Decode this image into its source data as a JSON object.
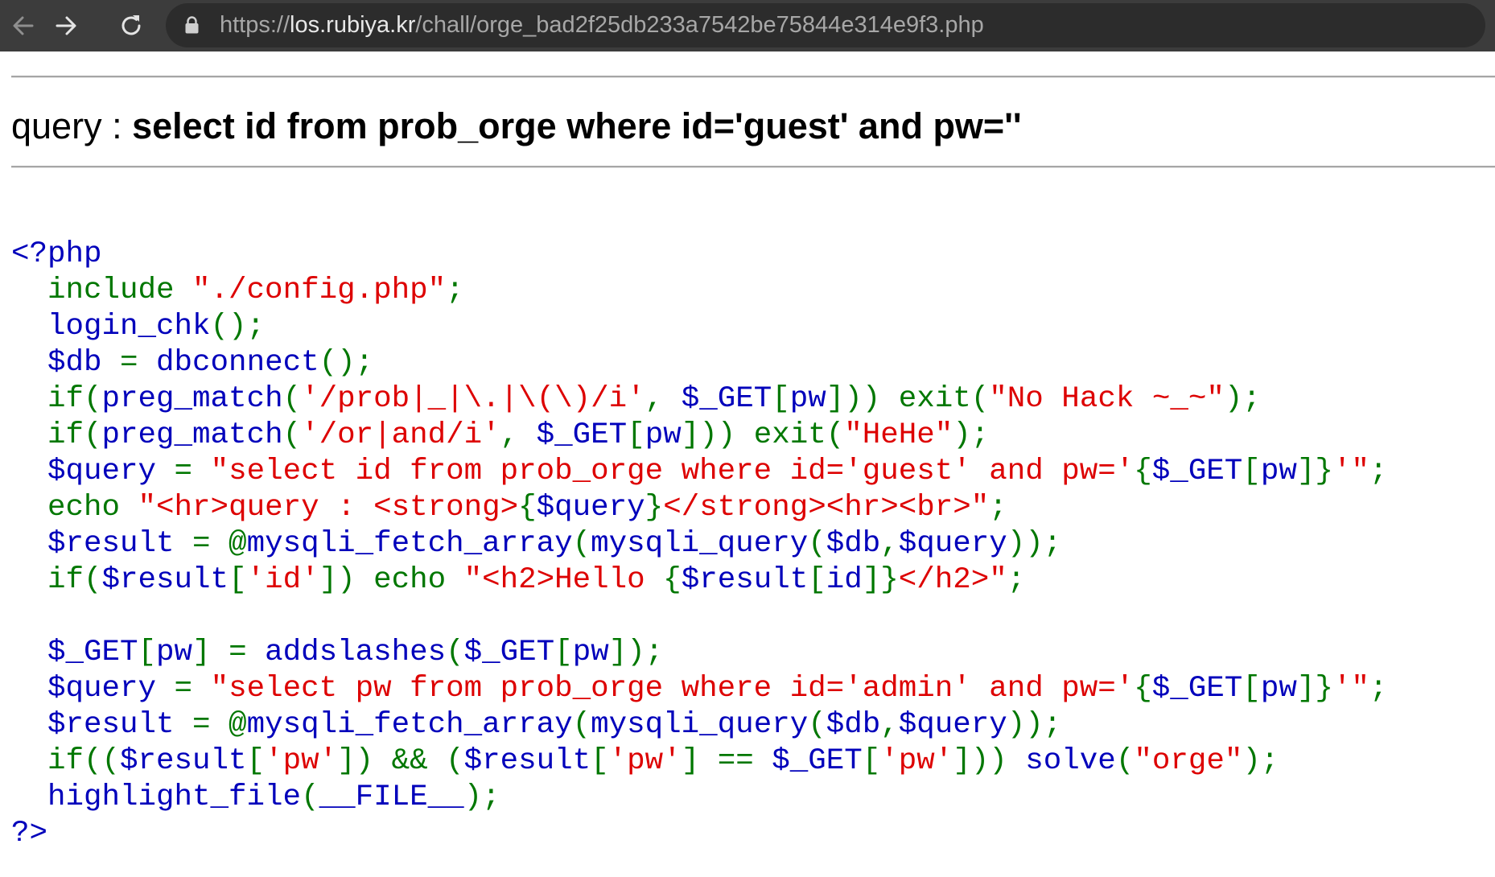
{
  "browser": {
    "url_scheme": "https://",
    "url_host": "los.rubiya.kr",
    "url_path": "/chall/orge_bad2f25db233a7542be75844e314e9f3.php"
  },
  "page": {
    "query_label": "query : ",
    "query_text": "select id from prob_orge where id='guest' and pw=''"
  },
  "code": {
    "lines": [
      [
        {
          "t": "<?php",
          "c": "d"
        }
      ],
      [
        {
          "t": "  ",
          "c": "d"
        },
        {
          "t": "include ",
          "c": "k"
        },
        {
          "t": "\"./config.php\"",
          "c": "s"
        },
        {
          "t": ";",
          "c": "k"
        }
      ],
      [
        {
          "t": "  login_chk",
          "c": "d"
        },
        {
          "t": "();",
          "c": "k"
        }
      ],
      [
        {
          "t": "  $db ",
          "c": "d"
        },
        {
          "t": "= ",
          "c": "k"
        },
        {
          "t": "dbconnect",
          "c": "d"
        },
        {
          "t": "();",
          "c": "k"
        }
      ],
      [
        {
          "t": "  ",
          "c": "d"
        },
        {
          "t": "if(",
          "c": "k"
        },
        {
          "t": "preg_match",
          "c": "d"
        },
        {
          "t": "(",
          "c": "k"
        },
        {
          "t": "'/prob|_|\\.|\\(\\)/i'",
          "c": "s"
        },
        {
          "t": ", ",
          "c": "k"
        },
        {
          "t": "$_GET",
          "c": "d"
        },
        {
          "t": "[",
          "c": "k"
        },
        {
          "t": "pw",
          "c": "d"
        },
        {
          "t": "])) exit(",
          "c": "k"
        },
        {
          "t": "\"No Hack ~_~\"",
          "c": "s"
        },
        {
          "t": ");",
          "c": "k"
        }
      ],
      [
        {
          "t": "  ",
          "c": "d"
        },
        {
          "t": "if(",
          "c": "k"
        },
        {
          "t": "preg_match",
          "c": "d"
        },
        {
          "t": "(",
          "c": "k"
        },
        {
          "t": "'/or|and/i'",
          "c": "s"
        },
        {
          "t": ", ",
          "c": "k"
        },
        {
          "t": "$_GET",
          "c": "d"
        },
        {
          "t": "[",
          "c": "k"
        },
        {
          "t": "pw",
          "c": "d"
        },
        {
          "t": "])) exit(",
          "c": "k"
        },
        {
          "t": "\"HeHe\"",
          "c": "s"
        },
        {
          "t": ");",
          "c": "k"
        }
      ],
      [
        {
          "t": "  $query ",
          "c": "d"
        },
        {
          "t": "= ",
          "c": "k"
        },
        {
          "t": "\"select id from prob_orge where id='guest' and pw='",
          "c": "s"
        },
        {
          "t": "{",
          "c": "k"
        },
        {
          "t": "$_GET",
          "c": "d"
        },
        {
          "t": "[",
          "c": "k"
        },
        {
          "t": "pw",
          "c": "d"
        },
        {
          "t": "]}",
          "c": "k"
        },
        {
          "t": "'\"",
          "c": "s"
        },
        {
          "t": ";",
          "c": "k"
        }
      ],
      [
        {
          "t": "  ",
          "c": "d"
        },
        {
          "t": "echo ",
          "c": "k"
        },
        {
          "t": "\"<hr>query : <strong>",
          "c": "s"
        },
        {
          "t": "{",
          "c": "k"
        },
        {
          "t": "$query",
          "c": "d"
        },
        {
          "t": "}",
          "c": "k"
        },
        {
          "t": "</strong><hr><br>\"",
          "c": "s"
        },
        {
          "t": ";",
          "c": "k"
        }
      ],
      [
        {
          "t": "  $result ",
          "c": "d"
        },
        {
          "t": "= @",
          "c": "k"
        },
        {
          "t": "mysqli_fetch_array",
          "c": "d"
        },
        {
          "t": "(",
          "c": "k"
        },
        {
          "t": "mysqli_query",
          "c": "d"
        },
        {
          "t": "(",
          "c": "k"
        },
        {
          "t": "$db",
          "c": "d"
        },
        {
          "t": ",",
          "c": "k"
        },
        {
          "t": "$query",
          "c": "d"
        },
        {
          "t": "));",
          "c": "k"
        }
      ],
      [
        {
          "t": "  ",
          "c": "d"
        },
        {
          "t": "if(",
          "c": "k"
        },
        {
          "t": "$result",
          "c": "d"
        },
        {
          "t": "[",
          "c": "k"
        },
        {
          "t": "'id'",
          "c": "s"
        },
        {
          "t": "]) echo ",
          "c": "k"
        },
        {
          "t": "\"<h2>Hello ",
          "c": "s"
        },
        {
          "t": "{",
          "c": "k"
        },
        {
          "t": "$result",
          "c": "d"
        },
        {
          "t": "[",
          "c": "k"
        },
        {
          "t": "id",
          "c": "d"
        },
        {
          "t": "]}",
          "c": "k"
        },
        {
          "t": "</h2>\"",
          "c": "s"
        },
        {
          "t": ";",
          "c": "k"
        }
      ],
      [
        {
          "t": "",
          "c": "d"
        }
      ],
      [
        {
          "t": "  $_GET",
          "c": "d"
        },
        {
          "t": "[",
          "c": "k"
        },
        {
          "t": "pw",
          "c": "d"
        },
        {
          "t": "] = ",
          "c": "k"
        },
        {
          "t": "addslashes",
          "c": "d"
        },
        {
          "t": "(",
          "c": "k"
        },
        {
          "t": "$_GET",
          "c": "d"
        },
        {
          "t": "[",
          "c": "k"
        },
        {
          "t": "pw",
          "c": "d"
        },
        {
          "t": "]);",
          "c": "k"
        }
      ],
      [
        {
          "t": "  $query ",
          "c": "d"
        },
        {
          "t": "= ",
          "c": "k"
        },
        {
          "t": "\"select pw from prob_orge where id='admin' and pw='",
          "c": "s"
        },
        {
          "t": "{",
          "c": "k"
        },
        {
          "t": "$_GET",
          "c": "d"
        },
        {
          "t": "[",
          "c": "k"
        },
        {
          "t": "pw",
          "c": "d"
        },
        {
          "t": "]}",
          "c": "k"
        },
        {
          "t": "'\"",
          "c": "s"
        },
        {
          "t": ";",
          "c": "k"
        }
      ],
      [
        {
          "t": "  $result ",
          "c": "d"
        },
        {
          "t": "= @",
          "c": "k"
        },
        {
          "t": "mysqli_fetch_array",
          "c": "d"
        },
        {
          "t": "(",
          "c": "k"
        },
        {
          "t": "mysqli_query",
          "c": "d"
        },
        {
          "t": "(",
          "c": "k"
        },
        {
          "t": "$db",
          "c": "d"
        },
        {
          "t": ",",
          "c": "k"
        },
        {
          "t": "$query",
          "c": "d"
        },
        {
          "t": "));",
          "c": "k"
        }
      ],
      [
        {
          "t": "  ",
          "c": "d"
        },
        {
          "t": "if((",
          "c": "k"
        },
        {
          "t": "$result",
          "c": "d"
        },
        {
          "t": "[",
          "c": "k"
        },
        {
          "t": "'pw'",
          "c": "s"
        },
        {
          "t": "]) && (",
          "c": "k"
        },
        {
          "t": "$result",
          "c": "d"
        },
        {
          "t": "[",
          "c": "k"
        },
        {
          "t": "'pw'",
          "c": "s"
        },
        {
          "t": "] == ",
          "c": "k"
        },
        {
          "t": "$_GET",
          "c": "d"
        },
        {
          "t": "[",
          "c": "k"
        },
        {
          "t": "'pw'",
          "c": "s"
        },
        {
          "t": "])) ",
          "c": "k"
        },
        {
          "t": "solve",
          "c": "d"
        },
        {
          "t": "(",
          "c": "k"
        },
        {
          "t": "\"orge\"",
          "c": "s"
        },
        {
          "t": ");",
          "c": "k"
        }
      ],
      [
        {
          "t": "  highlight_file",
          "c": "d"
        },
        {
          "t": "(",
          "c": "k"
        },
        {
          "t": "__FILE__",
          "c": "d"
        },
        {
          "t": ");",
          "c": "k"
        }
      ],
      [
        {
          "t": "?>",
          "c": "d"
        }
      ]
    ]
  }
}
